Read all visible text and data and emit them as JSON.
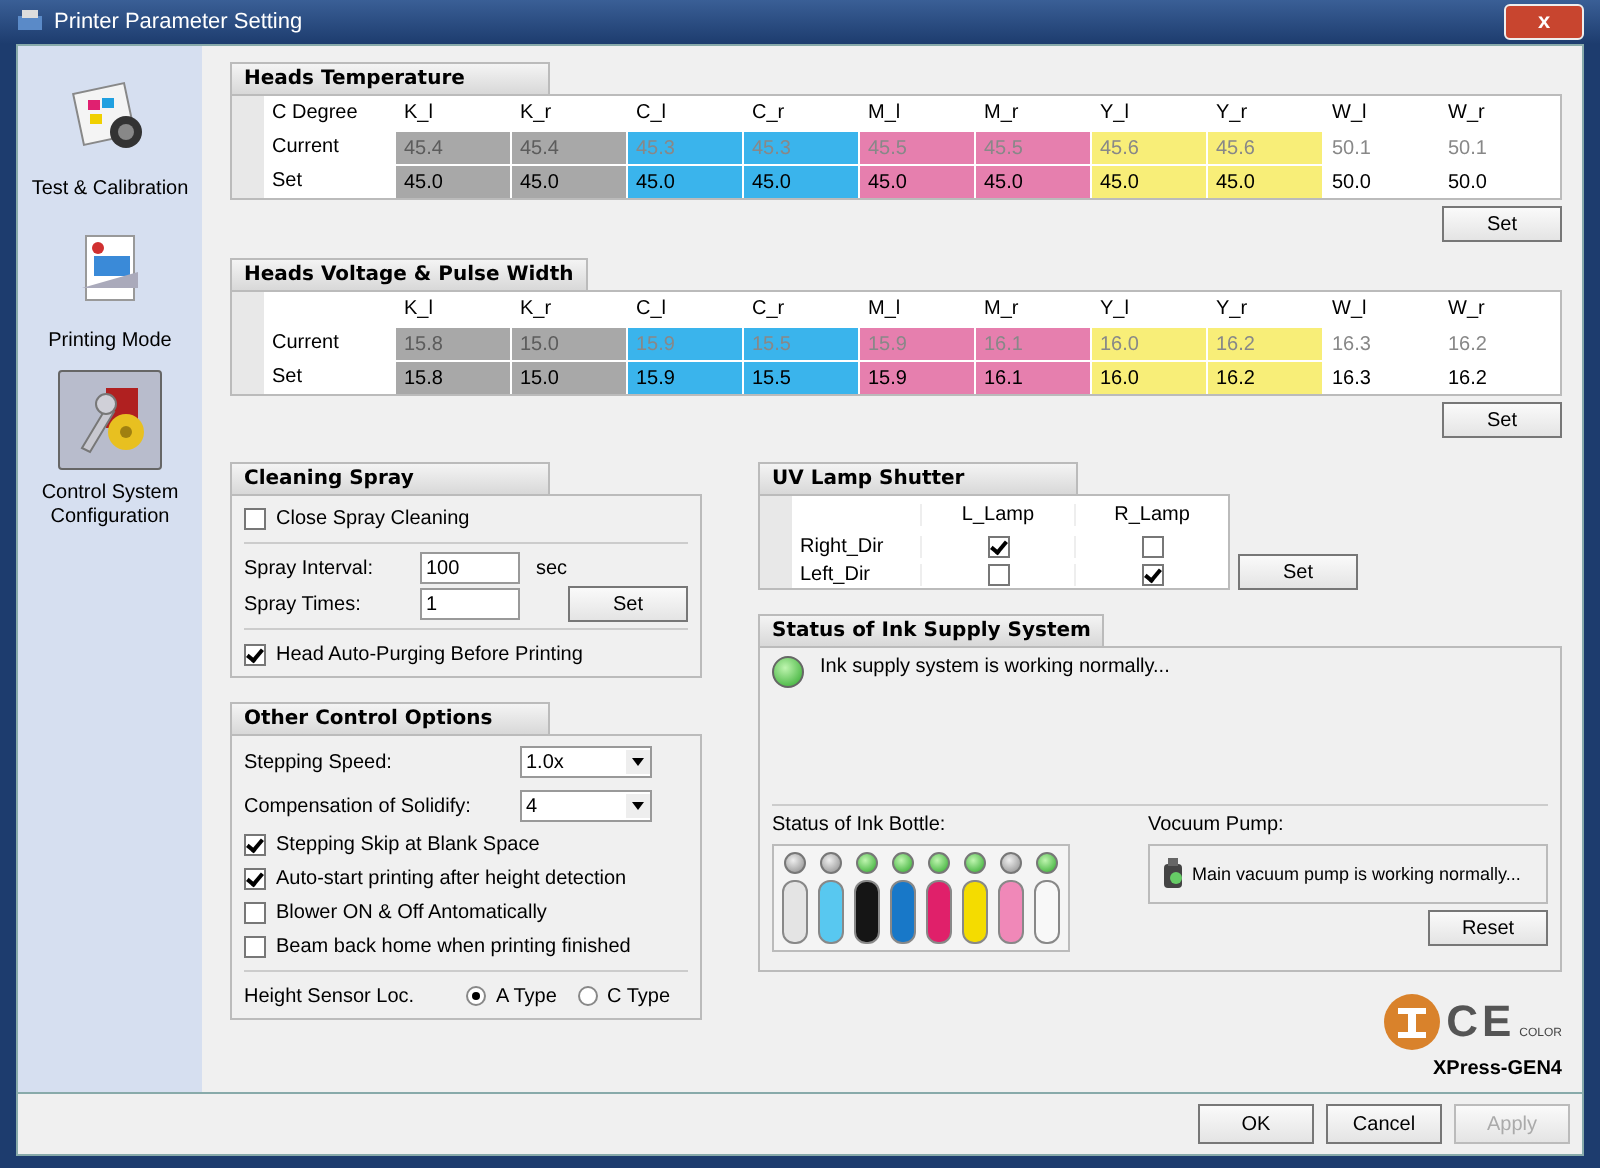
{
  "window": {
    "title": "Printer Parameter Setting",
    "close": "x"
  },
  "sidebar": {
    "items": [
      {
        "label": "Test & Calibration",
        "kind": "test",
        "selected": false
      },
      {
        "label": "Printing Mode",
        "kind": "mode",
        "selected": false
      },
      {
        "label": "Control System Configuration",
        "kind": "config",
        "selected": true
      }
    ]
  },
  "heads_temperature": {
    "title": "Heads Temperature",
    "corner": "C Degree",
    "columns": [
      {
        "label": "K_l",
        "color": "#a8a8a8"
      },
      {
        "label": "K_r",
        "color": "#a8a8a8"
      },
      {
        "label": "C_l",
        "color": "#3ab4ec"
      },
      {
        "label": "C_r",
        "color": "#3ab4ec"
      },
      {
        "label": "M_l",
        "color": "#e67fae"
      },
      {
        "label": "M_r",
        "color": "#e67fae"
      },
      {
        "label": "Y_l",
        "color": "#f8ee78"
      },
      {
        "label": "Y_r",
        "color": "#f8ee78"
      },
      {
        "label": "W_l",
        "color": "#ffffff"
      },
      {
        "label": "W_r",
        "color": "#ffffff"
      }
    ],
    "rows": [
      {
        "label": "Current",
        "kind": "current",
        "values": [
          "45.4",
          "45.4",
          "45.3",
          "45.3",
          "45.5",
          "45.5",
          "45.6",
          "45.6",
          "50.1",
          "50.1"
        ]
      },
      {
        "label": "Set",
        "kind": "set",
        "values": [
          "45.0",
          "45.0",
          "45.0",
          "45.0",
          "45.0",
          "45.0",
          "45.0",
          "45.0",
          "50.0",
          "50.0"
        ]
      }
    ],
    "button": "Set"
  },
  "heads_voltage": {
    "title": "Heads Voltage & Pulse Width",
    "columns": [
      {
        "label": "K_l",
        "color": "#a8a8a8"
      },
      {
        "label": "K_r",
        "color": "#a8a8a8"
      },
      {
        "label": "C_l",
        "color": "#3ab4ec"
      },
      {
        "label": "C_r",
        "color": "#3ab4ec"
      },
      {
        "label": "M_l",
        "color": "#e67fae"
      },
      {
        "label": "M_r",
        "color": "#e67fae"
      },
      {
        "label": "Y_l",
        "color": "#f8ee78"
      },
      {
        "label": "Y_r",
        "color": "#f8ee78"
      },
      {
        "label": "W_l",
        "color": "#ffffff"
      },
      {
        "label": "W_r",
        "color": "#ffffff"
      }
    ],
    "rows": [
      {
        "label": "Current",
        "kind": "current",
        "values": [
          "15.8",
          "15.0",
          "15.9",
          "15.5",
          "15.9",
          "16.1",
          "16.0",
          "16.2",
          "16.3",
          "16.2"
        ]
      },
      {
        "label": "Set",
        "kind": "set",
        "values": [
          "15.8",
          "15.0",
          "15.9",
          "15.5",
          "15.9",
          "16.1",
          "16.0",
          "16.2",
          "16.3",
          "16.2"
        ]
      }
    ],
    "button": "Set"
  },
  "cleaning_spray": {
    "title": "Cleaning Spray",
    "close_spray": {
      "label": "Close Spray Cleaning",
      "checked": false
    },
    "interval": {
      "label": "Spray Interval:",
      "value": "100",
      "unit": "sec"
    },
    "times": {
      "label": "Spray Times:",
      "value": "1"
    },
    "button": "Set",
    "auto_purge": {
      "label": "Head Auto-Purging Before Printing",
      "checked": true
    }
  },
  "other_options": {
    "title": "Other Control Options",
    "dropdowns": [
      {
        "label": "Stepping Speed:",
        "value": "1.0x"
      },
      {
        "label": "Compensation of Solidify:",
        "value": "4"
      }
    ],
    "checkboxes": [
      {
        "label": "Stepping Skip at Blank Space",
        "checked": true
      },
      {
        "label": "Auto-start printing after height detection",
        "checked": true
      },
      {
        "label": "Blower ON & Off Antomatically",
        "checked": false
      },
      {
        "label": "Beam back home when printing finished",
        "checked": false
      }
    ],
    "height_sensor": {
      "label": "Height Sensor Loc.",
      "options": [
        {
          "label": "A Type",
          "selected": true
        },
        {
          "label": "C Type",
          "selected": false
        }
      ]
    }
  },
  "uv_lamp": {
    "title": "UV Lamp Shutter",
    "columns": [
      "L_Lamp",
      "R_Lamp"
    ],
    "rows": [
      {
        "label": "Right_Dir",
        "checked": [
          true,
          false
        ]
      },
      {
        "label": "Left_Dir",
        "checked": [
          false,
          true
        ]
      }
    ],
    "button": "Set"
  },
  "ink_supply": {
    "title": "Status of Ink Supply System",
    "ok": true,
    "message": "Ink supply system is working normally...",
    "bottle_label": "Status of Ink Bottle:",
    "bottles": [
      {
        "color": "#e4e4e4",
        "ok": false
      },
      {
        "color": "#58c8f0",
        "ok": false
      },
      {
        "color": "#151515",
        "ok": true
      },
      {
        "color": "#1878c8",
        "ok": true
      },
      {
        "color": "#e0206a",
        "ok": true
      },
      {
        "color": "#f4dc00",
        "ok": true
      },
      {
        "color": "#f088b8",
        "ok": false
      },
      {
        "color": "#f8f8f8",
        "ok": true
      }
    ],
    "pump_label": "Vocuum Pump:",
    "pump_message": "Main vacuum pump is working normally...",
    "button": "Reset"
  },
  "brand": {
    "logo_text": "CE",
    "logo_sub": "COLOR",
    "model": "XPress-GEN4"
  },
  "buttons": [
    {
      "label": "OK",
      "disabled": false
    },
    {
      "label": "Cancel",
      "disabled": false
    },
    {
      "label": "Apply",
      "disabled": true
    }
  ]
}
